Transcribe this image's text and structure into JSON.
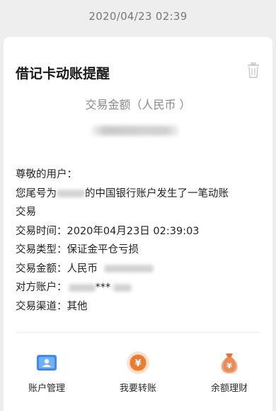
{
  "header": {
    "timestamp": "2020/04/23 02:39"
  },
  "card": {
    "title": "借记卡动账提醒",
    "amount_label": "交易金额（人民币 ）",
    "greeting": "尊敬的用户：",
    "msg_prefix": "您尾号为",
    "msg_suffix": "的中国银行账户发生了一笔动账",
    "msg_line2": "交易",
    "time_label": "交易时间：",
    "time_value": "2020年04月23日 02:39:03",
    "type_label": "交易类型：",
    "type_value": "保证金平仓亏损",
    "amt_label": "交易金额：",
    "amt_value": "人民币",
    "counter_label": "对方账户：",
    "counter_mid": "***",
    "channel_label": "交易渠道：",
    "channel_value": "其他"
  },
  "actions": [
    {
      "label": "账户管理",
      "icon": "account-card-icon"
    },
    {
      "label": "我要转账",
      "icon": "transfer-coin-icon"
    },
    {
      "label": "余额理财",
      "icon": "money-bag-icon"
    }
  ],
  "colors": {
    "accent_blue": "#3d8bf2",
    "accent_orange": "#f07a2c"
  }
}
